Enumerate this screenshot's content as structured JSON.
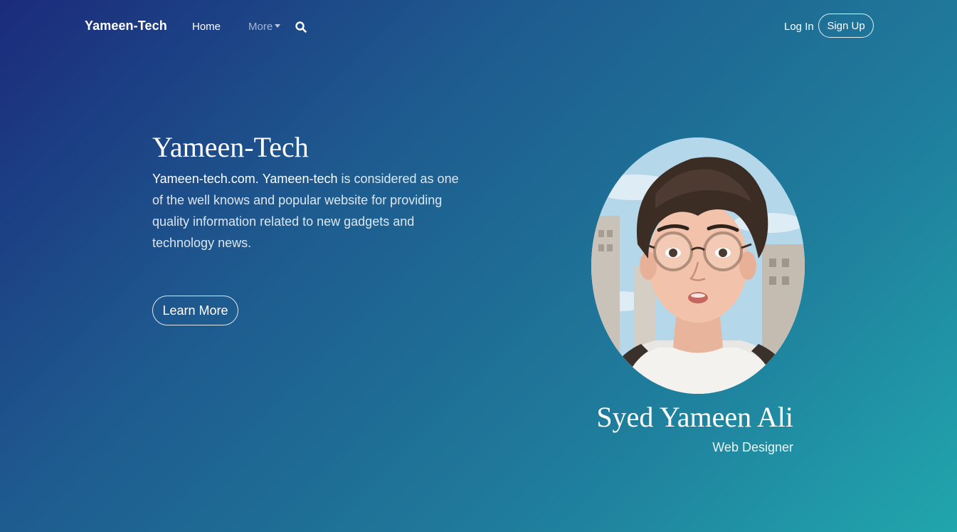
{
  "navbar": {
    "brand": "Yameen-Tech",
    "home_label": "Home",
    "more_label": "More",
    "search_icon": "search-icon",
    "login_label": "Log In",
    "signup_label": "Sign Up"
  },
  "hero": {
    "title": "Yameen-Tech",
    "description_bold_1": "Yameen-tech.com.",
    "description_bold_2": "Yameen-tech",
    "description_rest": " is considered as one of the well knows and popular website for providing quality information related to new gadgets and technology news.",
    "button_label": "Learn More"
  },
  "profile": {
    "name": "Syed Yameen Ali",
    "role": "Web Designer",
    "avatar_icon": "avatar"
  },
  "colors": {
    "gradient_start": "#1b2b7c",
    "gradient_end": "#21a6ad",
    "text": "#ffffff"
  }
}
